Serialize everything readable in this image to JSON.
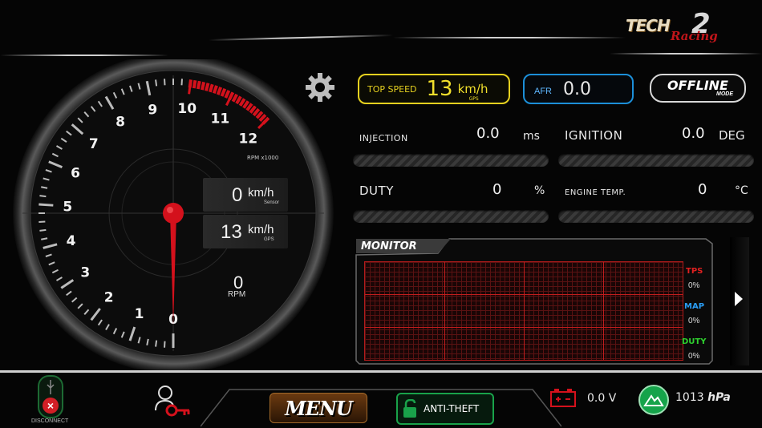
{
  "brand": {
    "line1": "TECH",
    "line2": "2",
    "line3": "Racing"
  },
  "top_speed": {
    "label": "TOP SPEED",
    "value": "13",
    "unit": "km/h",
    "source": "GPS"
  },
  "afr": {
    "label": "AFR",
    "value": "0.0"
  },
  "mode": {
    "line1": "OFFLINE",
    "line2": "MODE"
  },
  "readouts": {
    "injection": {
      "label": "INJECTION",
      "value": "0.0",
      "unit": "ms"
    },
    "ignition": {
      "label": "IGNITION",
      "value": "0.0",
      "unit": "DEG"
    },
    "duty": {
      "label": "DUTY",
      "value": "0",
      "unit": "%"
    },
    "engine_temp": {
      "label": "ENGINE TEMP.",
      "value": "0",
      "unit": "°C"
    }
  },
  "monitor": {
    "title": "MONITOR",
    "legend": [
      {
        "name": "TPS",
        "value": "0%",
        "color": "#e02020"
      },
      {
        "name": "MAP",
        "value": "0%",
        "color": "#2a9df4"
      },
      {
        "name": "DUTY",
        "value": "0%",
        "color": "#2ed12e"
      }
    ]
  },
  "gauge": {
    "rpm_labels": [
      "0",
      "1",
      "2",
      "3",
      "4",
      "5",
      "6",
      "7",
      "8",
      "9",
      "10",
      "11",
      "12"
    ],
    "rpm_unit": "RPM x1000",
    "redline_start": 10,
    "rpm_value": 0,
    "speed_sensor": {
      "value": "0",
      "unit": "km/h",
      "source": "Sensor"
    },
    "speed_gps": {
      "value": "13",
      "unit": "km/h",
      "source": "GPS"
    },
    "rpm_readout": {
      "value": "0",
      "unit": "RPM"
    }
  },
  "bottom": {
    "disconnect_label": "DISCONNECT",
    "menu_label": "MENU",
    "anti_theft_label": "ANTI-THEFT",
    "battery": "0.0 V",
    "pressure_value": "1013",
    "pressure_unit": "hPa"
  },
  "colors": {
    "accent_yellow": "#e6d11f",
    "accent_blue": "#1c8fd8",
    "redline": "#d4111c",
    "green": "#19a24a"
  }
}
